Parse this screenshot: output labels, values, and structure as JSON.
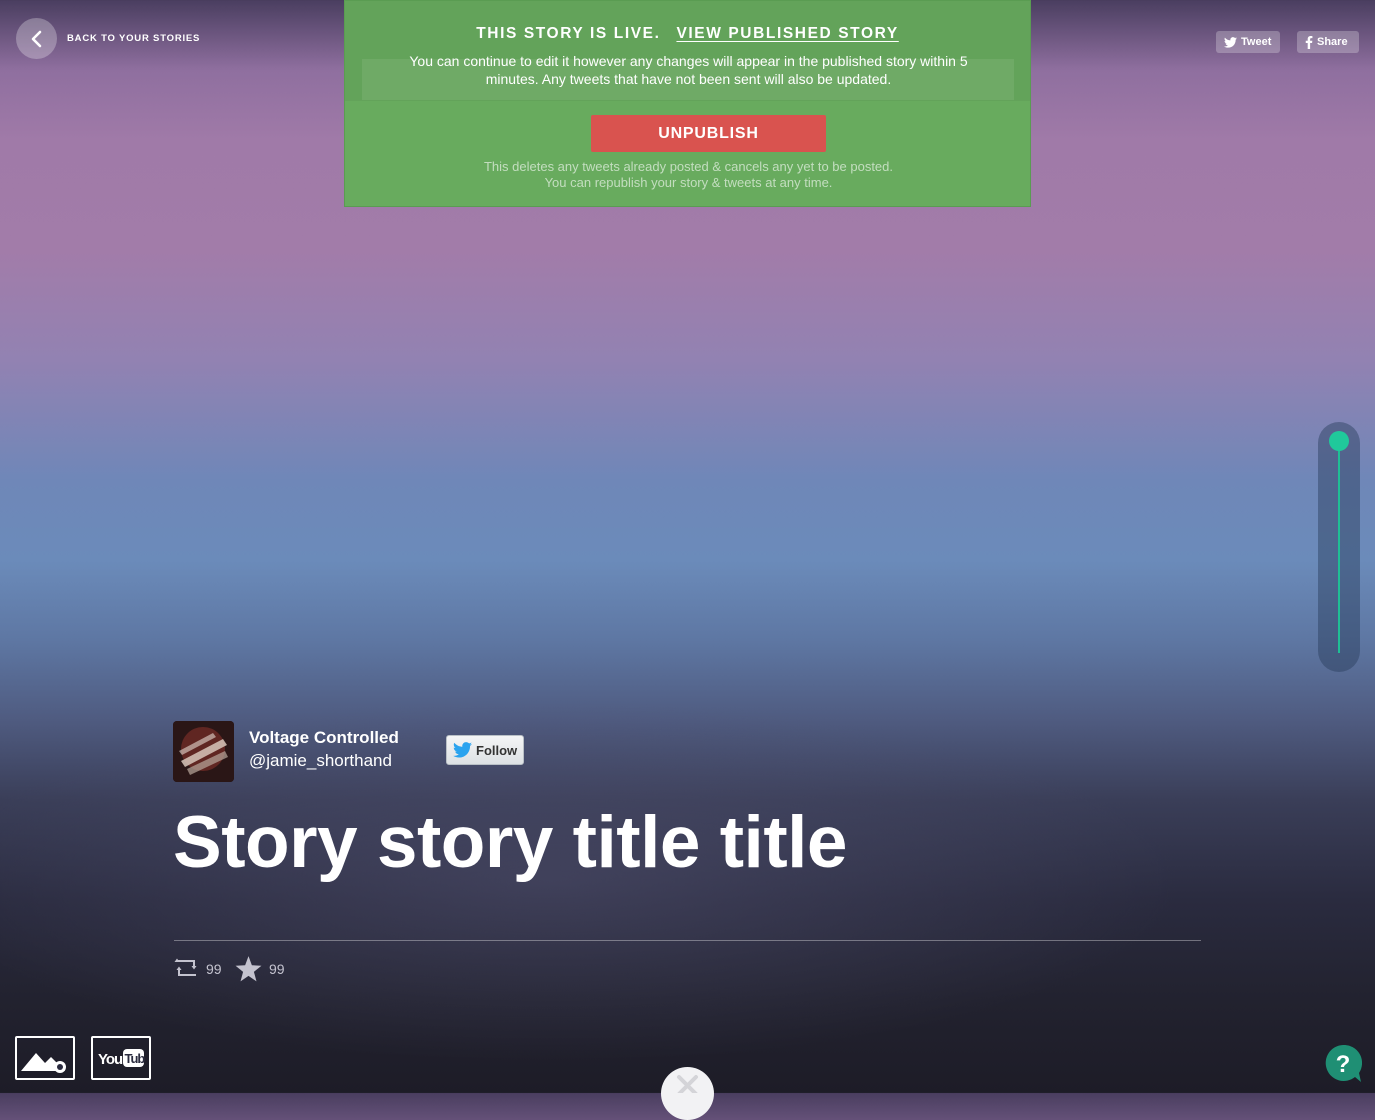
{
  "nav": {
    "back_label": "BACK TO YOUR STORIES"
  },
  "share": {
    "tweet_label": "Tweet",
    "share_label": "Share"
  },
  "publish_banner": {
    "status_text": "THIS STORY IS LIVE.",
    "view_link": "VIEW PUBLISHED STORY",
    "message": "You can continue to edit it however any changes will appear in the published story within 5 minutes. Any tweets that have not been sent will also be updated.",
    "unpublish_label": "UNPUBLISH",
    "note_line1": "This deletes any tweets already posted & cancels any yet to be posted.",
    "note_line2": "You can republish your story & tweets at any time."
  },
  "author": {
    "name": "Voltage Controlled",
    "handle": "@jamie_shorthand",
    "follow_label": "Follow"
  },
  "story": {
    "title": "Story story title title"
  },
  "stats": {
    "retweets": "99",
    "favorites": "99"
  },
  "colors": {
    "banner_green": "#68ab5e",
    "unpublish_red": "#d9534f",
    "scroll_accent": "#20c99b",
    "help_teal": "#1f8f74"
  },
  "icons": {
    "back": "chevron-left-icon",
    "tweet": "twitter-bird-icon",
    "share": "facebook-f-icon",
    "retweet": "retweet-icon",
    "favorite": "star-icon",
    "image": "mountain-image-icon",
    "video": "youtube-icon",
    "scroll_down": "close-x-icon",
    "help": "question-icon"
  },
  "media_buttons": {
    "youtube_label": "You Tube"
  },
  "help": {
    "label": "?"
  }
}
